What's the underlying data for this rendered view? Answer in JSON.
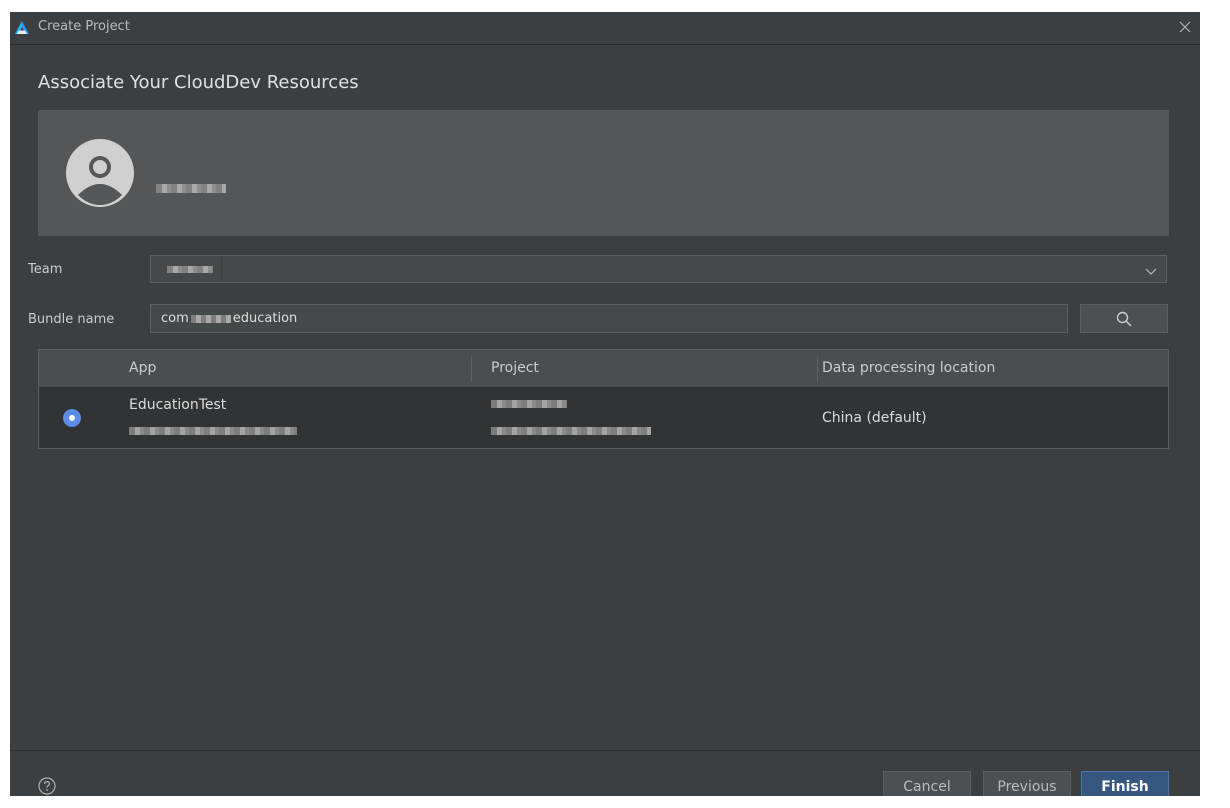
{
  "window": {
    "title": "Create Project"
  },
  "page": {
    "heading": "Associate Your CloudDev Resources"
  },
  "form": {
    "team_label": "Team",
    "bundle_label": "Bundle name",
    "bundle_prefix": "com",
    "bundle_suffix": "education"
  },
  "table": {
    "headers": [
      "App",
      "Project",
      "Data processing location"
    ],
    "rows": [
      {
        "app": "EducationTest",
        "location": "China (default)",
        "selected": true
      }
    ]
  },
  "footer": {
    "cancel": "Cancel",
    "previous": "Previous",
    "finish": "Finish"
  },
  "icons": {
    "logo": "harmony-logo-icon",
    "close": "close-icon",
    "avatar": "user-avatar-icon",
    "dropdown": "chevron-down-icon",
    "search": "search-icon",
    "help": "help-icon"
  },
  "colors": {
    "background": "#3c3f41",
    "accent": "#5c8ce6",
    "primary_button": "#365880"
  }
}
